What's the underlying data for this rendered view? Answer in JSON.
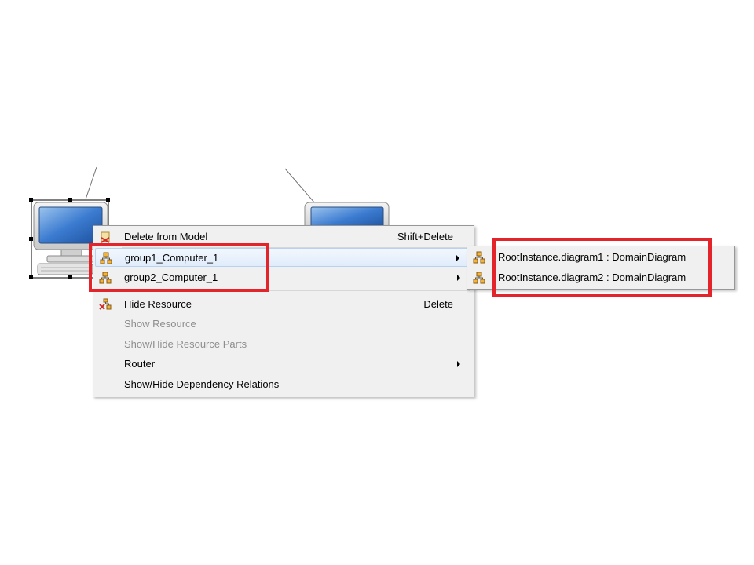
{
  "context_menu": {
    "items": [
      {
        "label": "Delete from Model",
        "shortcut": "Shift+Delete",
        "icon": "delete-model-icon",
        "enabled": true
      },
      {
        "label": "group1_Computer_1",
        "icon": "group-icon",
        "submenu": true,
        "enabled": true,
        "highlighted": true
      },
      {
        "label": "group2_Computer_1",
        "icon": "group-icon",
        "submenu": true,
        "enabled": true
      },
      {
        "label": "Hide Resource",
        "shortcut": "Delete",
        "icon": "hide-resource-icon",
        "enabled": true
      },
      {
        "label": "Show Resource",
        "enabled": false
      },
      {
        "label": "Show/Hide Resource Parts",
        "enabled": false
      },
      {
        "label": "Router",
        "submenu": true,
        "enabled": true
      },
      {
        "label": "Show/Hide Dependency Relations",
        "enabled": true
      }
    ]
  },
  "submenu": {
    "items": [
      {
        "label": "RootInstance.diagram1 : DomainDiagram",
        "icon": "group-icon"
      },
      {
        "label": "RootInstance.diagram2 : DomainDiagram",
        "icon": "group-icon"
      }
    ]
  },
  "colors": {
    "highlight_box": "#e3242b",
    "menu_background": "#f0f0f0",
    "monitor_blue": "#2f6fbf"
  }
}
